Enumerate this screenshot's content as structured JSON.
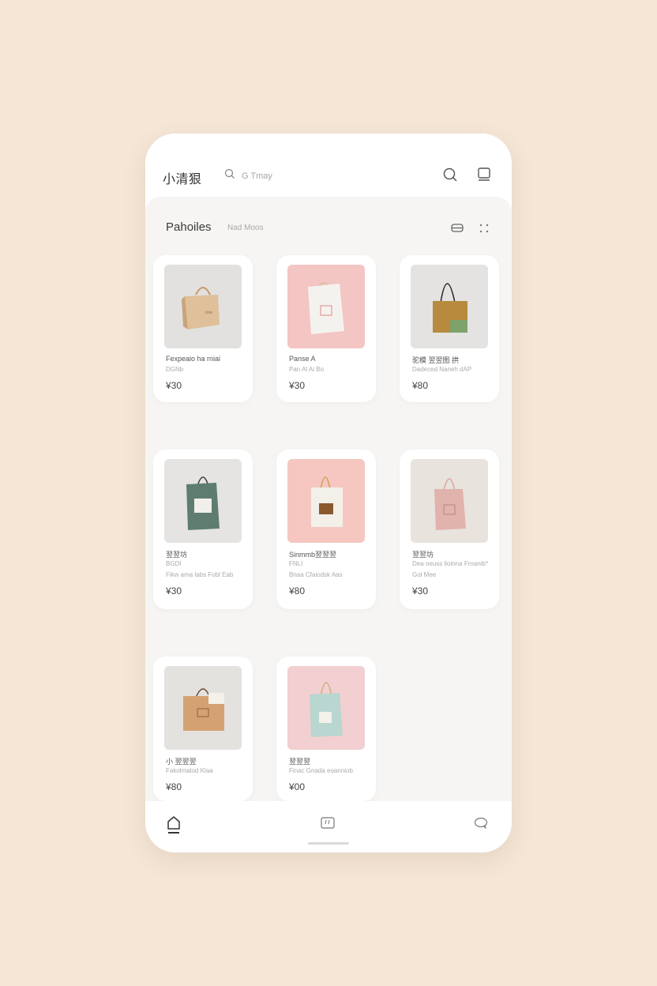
{
  "header": {
    "title": "小清狠",
    "search_placeholder": "G Tmay",
    "icons": [
      "search-icon",
      "bag-icon"
    ]
  },
  "section": {
    "title": "Pahoiles",
    "subtitle": "Nad Moos",
    "icons": [
      "list-view-icon",
      "grid-view-icon"
    ]
  },
  "products": [
    {
      "name": "Fexpeaio ha rniai",
      "sub": "DGNb",
      "price": "¥30",
      "bag_color": "#e0c09a",
      "bg_color": "#e2e1df",
      "handle_color": "#c79a6a"
    },
    {
      "name": "Panse A",
      "sub": "Pan Al Ai Bo",
      "price": "¥30",
      "bag_color": "#f4f2ee",
      "bg_color": "#f3c5c3",
      "handle_color": "#d9b89a"
    },
    {
      "name": "驼模 翌翌图 拱",
      "sub": "Dadeced Naneh dAP",
      "price": "¥80",
      "bag_color": "#b78a3e",
      "bg_color": "#e4e3e1",
      "handle_color": "#222222"
    },
    {
      "name": "翌翌坊",
      "sub": "BGDI",
      "sub2": "Fikw ama labs Fobl Eab",
      "price": "¥30",
      "bag_color": "#5e7d70",
      "bg_color": "#e5e4e2",
      "handle_color": "#3a3a3a"
    },
    {
      "name": "Sinmmb翌翌翌",
      "sub": "FNLI",
      "sub2": "Bnaa Cfaiodsk Aas",
      "price": "¥80",
      "bag_color": "#f3f0ea",
      "bg_color": "#f5c7c0",
      "handle_color": "#d3a056"
    },
    {
      "name": "翌翌坊",
      "sub": "Dea oeuss lioinna Froanib*",
      "sub2": "Gol Mee",
      "price": "¥30",
      "bag_color": "#e0b3ac",
      "bg_color": "#e8e3dc",
      "handle_color": "#d9a6a0"
    },
    {
      "name": "小 翌翌翌",
      "sub": "Fakolmalod Klaa",
      "price": "¥80",
      "bag_color": "#d4a272",
      "bg_color": "#e3e2df",
      "handle_color": "#6a4a30"
    },
    {
      "name": "翌翌翌",
      "sub": "Finac Gnada eoanniob",
      "price": "¥00",
      "bag_color": "#b9d6d0",
      "bg_color": "#f2cfd0",
      "handle_color": "#d2b07a"
    }
  ],
  "bottom_nav": {
    "items": [
      "home-icon",
      "compose-icon",
      "chat-icon"
    ]
  }
}
